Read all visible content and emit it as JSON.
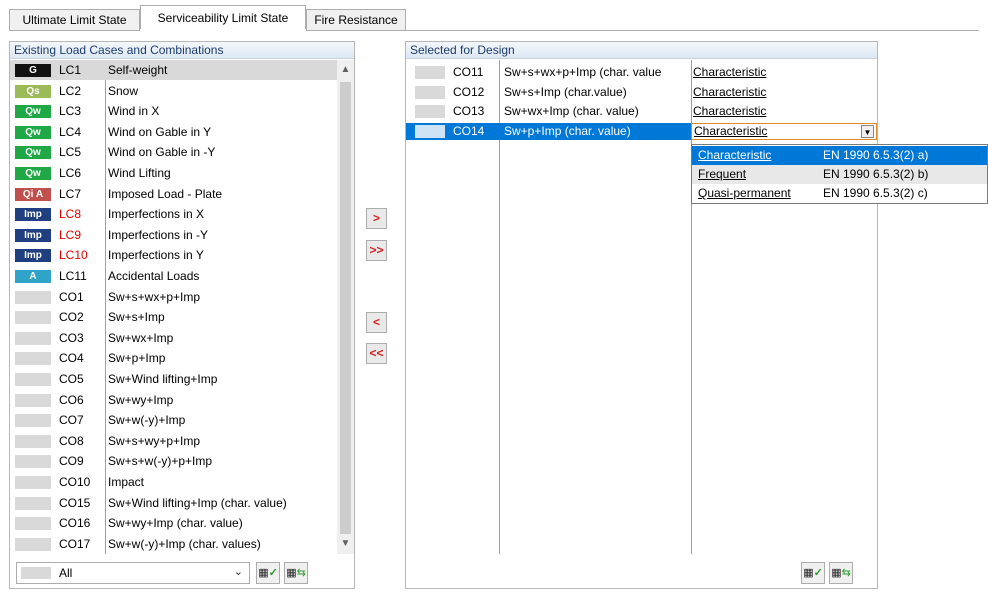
{
  "tabs": [
    "Ultimate Limit State",
    "Serviceability Limit State",
    "Fire Resistance"
  ],
  "left_panel": {
    "title": "Existing Load Cases and Combinations",
    "rows": [
      {
        "badge": "G",
        "badge_color": "#111111",
        "id": "LC1",
        "desc": "Self-weight",
        "red": false
      },
      {
        "badge": "Qs",
        "badge_color": "#9bbb59",
        "id": "LC2",
        "desc": "Snow",
        "red": false
      },
      {
        "badge": "Qw",
        "badge_color": "#1fa845",
        "id": "LC3",
        "desc": "Wind in X",
        "red": false
      },
      {
        "badge": "Qw",
        "badge_color": "#1fa845",
        "id": "LC4",
        "desc": "Wind on Gable in Y",
        "red": false
      },
      {
        "badge": "Qw",
        "badge_color": "#1fa845",
        "id": "LC5",
        "desc": "Wind on Gable in -Y",
        "red": false
      },
      {
        "badge": "Qw",
        "badge_color": "#1fa845",
        "id": "LC6",
        "desc": "Wind Lifting",
        "red": false
      },
      {
        "badge": "Qi A",
        "badge_color": "#c0504d",
        "id": "LC7",
        "desc": "Imposed Load - Plate",
        "red": false
      },
      {
        "badge": "Imp",
        "badge_color": "#1f3f80",
        "id": "LC8",
        "desc": "Imperfections in X",
        "red": true
      },
      {
        "badge": "Imp",
        "badge_color": "#1f3f80",
        "id": "LC9",
        "desc": "Imperfections in -Y",
        "red": true
      },
      {
        "badge": "Imp",
        "badge_color": "#1f3f80",
        "id": "LC10",
        "desc": "Imperfections in Y",
        "red": true
      },
      {
        "badge": "A",
        "badge_color": "#2fa3c8",
        "id": "LC11",
        "desc": "Accidental Loads",
        "red": false
      },
      {
        "badge": "",
        "badge_color": "#d9d9d9",
        "id": "CO1",
        "desc": "Sw+s+wx+p+Imp",
        "red": false
      },
      {
        "badge": "",
        "badge_color": "#d9d9d9",
        "id": "CO2",
        "desc": "Sw+s+Imp",
        "red": false
      },
      {
        "badge": "",
        "badge_color": "#d9d9d9",
        "id": "CO3",
        "desc": "Sw+wx+Imp",
        "red": false
      },
      {
        "badge": "",
        "badge_color": "#d9d9d9",
        "id": "CO4",
        "desc": "Sw+p+Imp",
        "red": false
      },
      {
        "badge": "",
        "badge_color": "#d9d9d9",
        "id": "CO5",
        "desc": "Sw+Wind lifting+Imp",
        "red": false
      },
      {
        "badge": "",
        "badge_color": "#d9d9d9",
        "id": "CO6",
        "desc": "Sw+wy+Imp",
        "red": false
      },
      {
        "badge": "",
        "badge_color": "#d9d9d9",
        "id": "CO7",
        "desc": "Sw+w(-y)+Imp",
        "red": false
      },
      {
        "badge": "",
        "badge_color": "#d9d9d9",
        "id": "CO8",
        "desc": "Sw+s+wy+p+Imp",
        "red": false
      },
      {
        "badge": "",
        "badge_color": "#d9d9d9",
        "id": "CO9",
        "desc": "Sw+s+w(-y)+p+Imp",
        "red": false
      },
      {
        "badge": "",
        "badge_color": "#d9d9d9",
        "id": "CO10",
        "desc": "Impact",
        "red": false
      },
      {
        "badge": "",
        "badge_color": "#d9d9d9",
        "id": "CO15",
        "desc": "Sw+Wind lifting+Imp (char. value)",
        "red": false
      },
      {
        "badge": "",
        "badge_color": "#d9d9d9",
        "id": "CO16",
        "desc": "Sw+wy+Imp (char. value)",
        "red": false
      },
      {
        "badge": "",
        "badge_color": "#d9d9d9",
        "id": "CO17",
        "desc": "Sw+w(-y)+Imp (char. values)",
        "red": false
      }
    ],
    "filter_value": "All"
  },
  "middle_buttons": [
    "add-selected",
    "add-all",
    "remove-selected",
    "remove-all"
  ],
  "right_panel": {
    "title": "Selected for Design",
    "rows": [
      {
        "id": "CO11",
        "desc": "Sw+s+wx+p+Imp (char. value",
        "category": "Characteristic"
      },
      {
        "id": "CO12",
        "desc": "Sw+s+Imp (char.value)",
        "category": "Characteristic"
      },
      {
        "id": "CO13",
        "desc": "Sw+wx+Imp (char. value)",
        "category": "Characteristic"
      },
      {
        "id": "CO14",
        "desc": "Sw+p+Imp (char. value)",
        "category": "Characteristic"
      }
    ],
    "dropdown_options": [
      {
        "label": "Characteristic",
        "ref": "EN 1990 6.5.3(2) a)"
      },
      {
        "label": "Frequent",
        "ref": "EN 1990 6.5.3(2) b)"
      },
      {
        "label": "Quasi-permanent",
        "ref": "EN 1990 6.5.3(2) c)"
      }
    ]
  }
}
